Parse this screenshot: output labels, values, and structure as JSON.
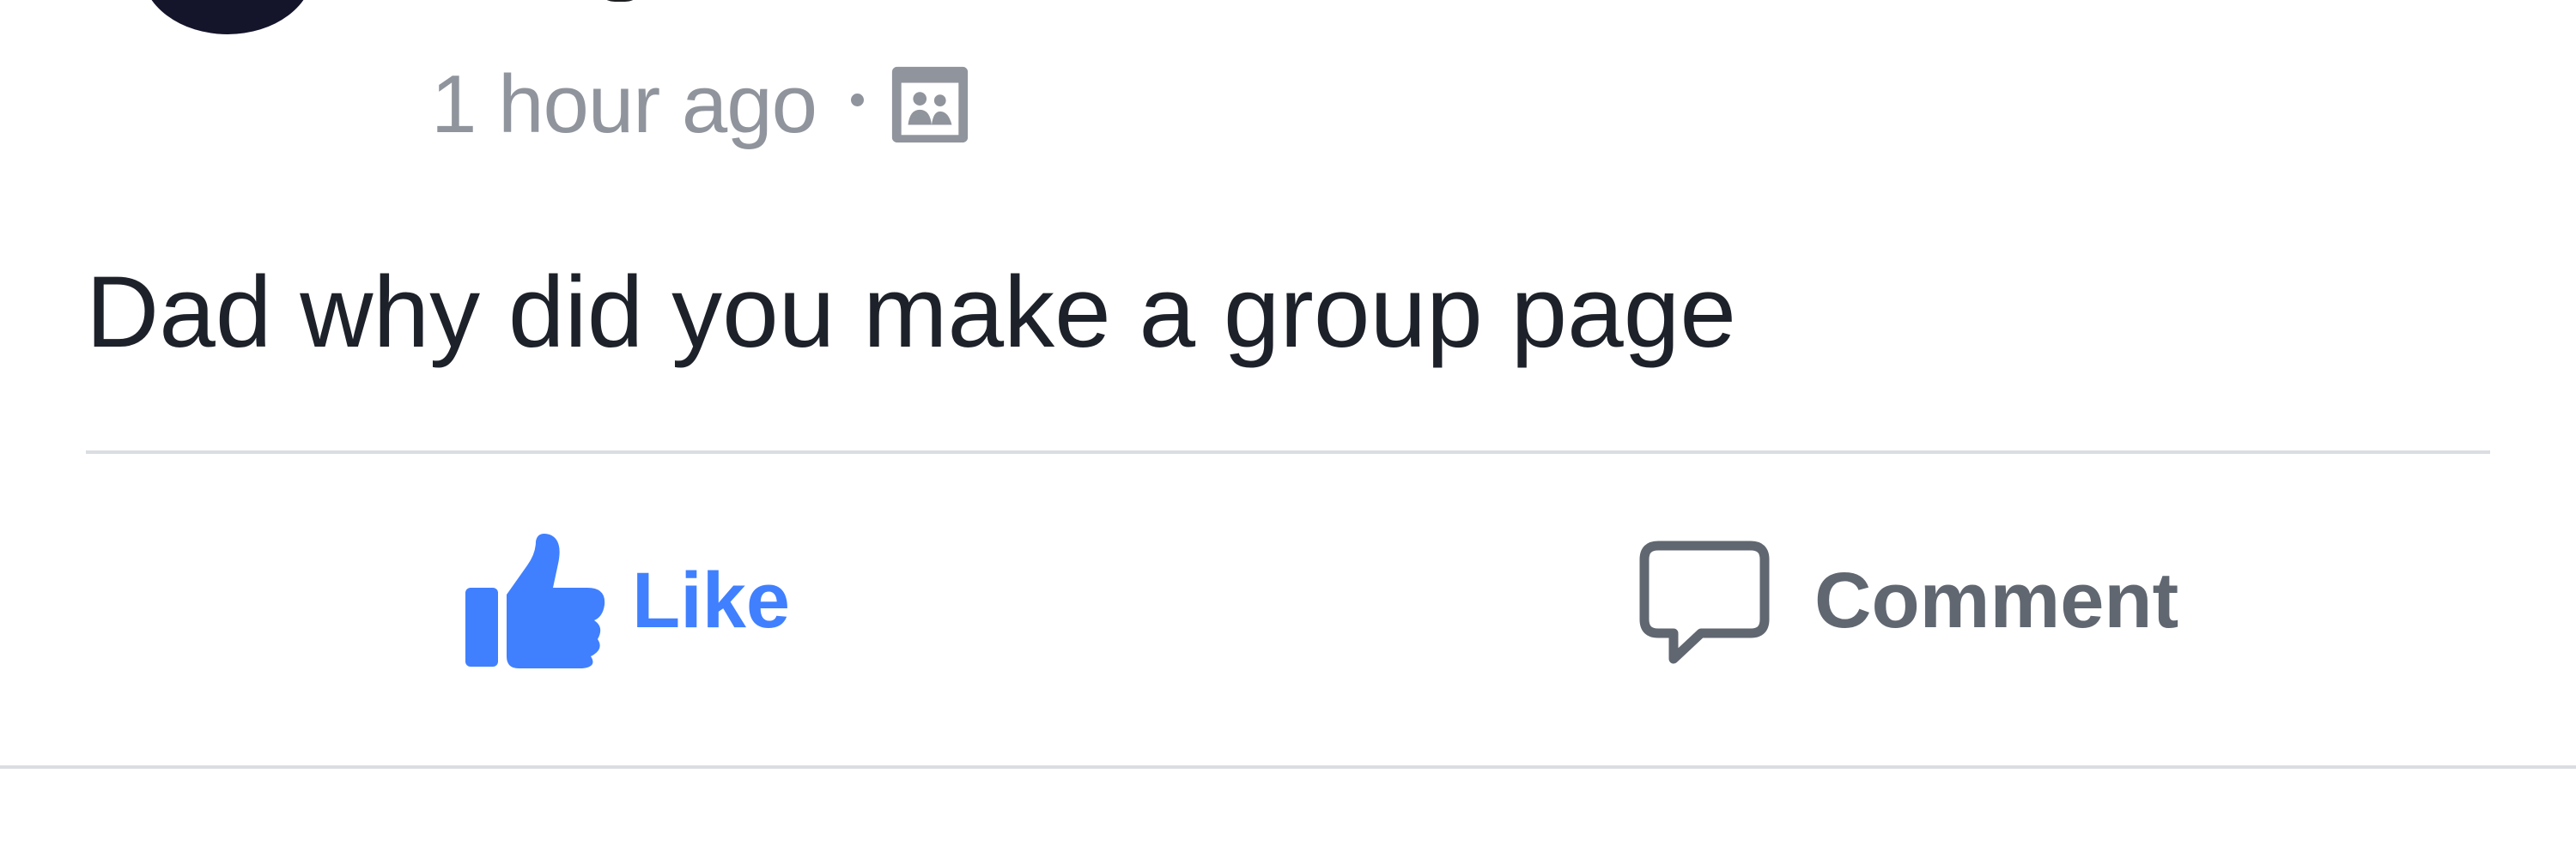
{
  "post": {
    "timestamp": "1 hour ago",
    "audience_icon": "group-audience-icon",
    "text": "Dad why did you make a group page"
  },
  "actions": {
    "like_label": "Like",
    "like_icon": "thumbs-up-icon",
    "comment_label": "Comment",
    "comment_icon": "speech-bubble-icon"
  },
  "colors": {
    "like_blue": "#4080ff",
    "meta_gray": "#90949c",
    "action_gray": "#606770",
    "text_dark": "#1d2129",
    "divider": "#dadde1"
  }
}
